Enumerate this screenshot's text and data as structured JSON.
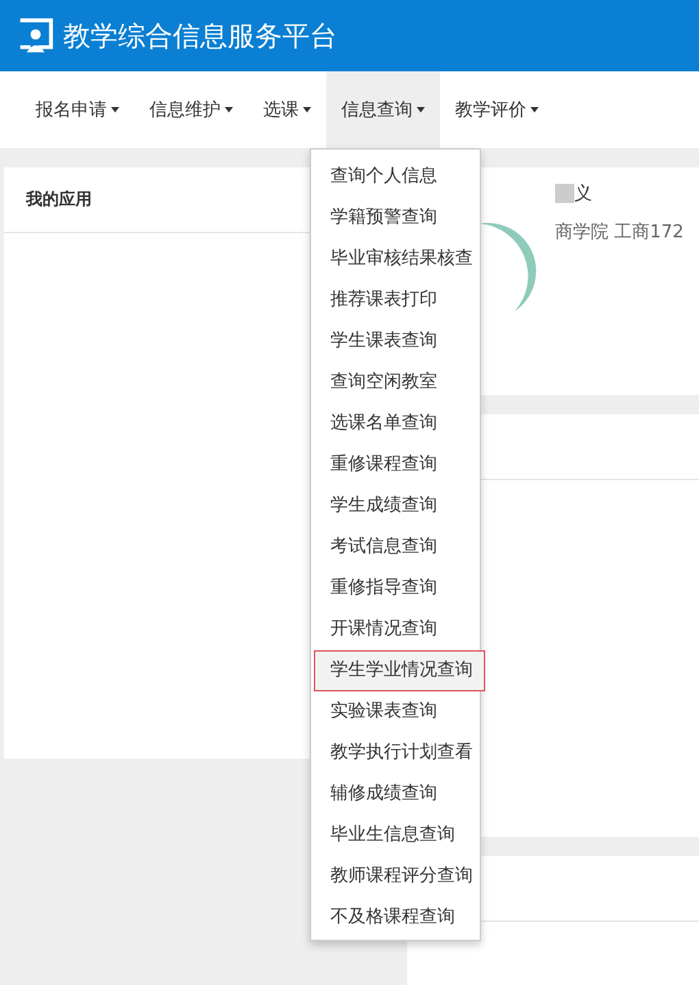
{
  "header": {
    "title": "教学综合信息服务平台"
  },
  "nav": [
    {
      "label": "报名申请",
      "selected": false
    },
    {
      "label": "信息维护",
      "selected": false
    },
    {
      "label": "选课",
      "selected": false
    },
    {
      "label": "信息查询",
      "selected": true
    },
    {
      "label": "教学评价",
      "selected": false
    }
  ],
  "dropdown": {
    "items": [
      {
        "label": "查询个人信息",
        "selected": false
      },
      {
        "label": "学籍预警查询",
        "selected": false
      },
      {
        "label": "毕业审核结果核查",
        "selected": false
      },
      {
        "label": "推荐课表打印",
        "selected": false
      },
      {
        "label": "学生课表查询",
        "selected": false
      },
      {
        "label": "查询空闲教室",
        "selected": false
      },
      {
        "label": "选课名单查询",
        "selected": false
      },
      {
        "label": "重修课程查询",
        "selected": false
      },
      {
        "label": "学生成绩查询",
        "selected": false
      },
      {
        "label": "考试信息查询",
        "selected": false
      },
      {
        "label": "重修指导查询",
        "selected": false
      },
      {
        "label": "开课情况查询",
        "selected": false
      },
      {
        "label": "学生学业情况查询",
        "selected": true
      },
      {
        "label": "实验课表查询",
        "selected": false
      },
      {
        "label": "教学执行计划查看",
        "selected": false
      },
      {
        "label": "辅修成绩查询",
        "selected": false
      },
      {
        "label": "毕业生信息查询",
        "selected": false
      },
      {
        "label": "教师课程评分查询",
        "selected": false
      },
      {
        "label": "不及格课程查询",
        "selected": false
      }
    ]
  },
  "apps_panel": {
    "title": "我的应用"
  },
  "profile": {
    "name": "义",
    "class": "商学院 工商172"
  }
}
